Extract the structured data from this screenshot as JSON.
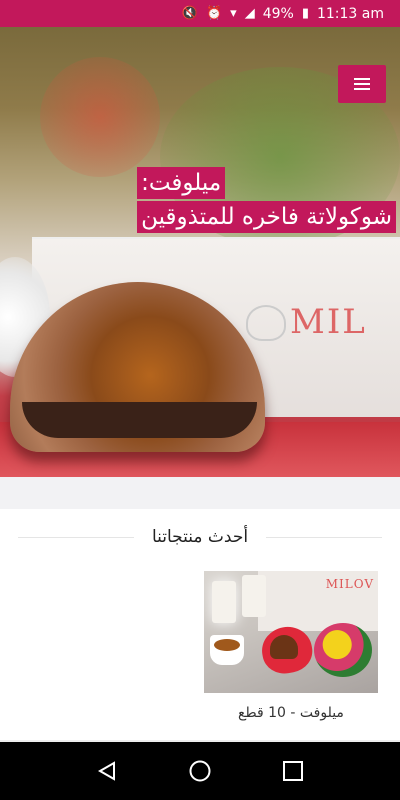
{
  "status_bar": {
    "battery": "49%",
    "time": "11:13 am",
    "icons": [
      "mute-icon",
      "alarm-icon",
      "wifi-icon",
      "signal-icon",
      "battery-icon"
    ]
  },
  "header": {
    "menu_icon": "hamburger-icon",
    "accent_color": "#c2185b"
  },
  "hero": {
    "title_line1": "ميلوفت:",
    "title_line2": "شوكولاتة فاخره للمتذوقين",
    "box_brand": "MIL"
  },
  "latest_products": {
    "title": "أحدث منتجاتنا",
    "items": [
      {
        "name": "ميلوفت - 10 قطع",
        "image_brand": "MILOV"
      }
    ]
  },
  "nav_bar": {
    "buttons": [
      "back-icon",
      "home-icon",
      "recents-icon"
    ]
  }
}
